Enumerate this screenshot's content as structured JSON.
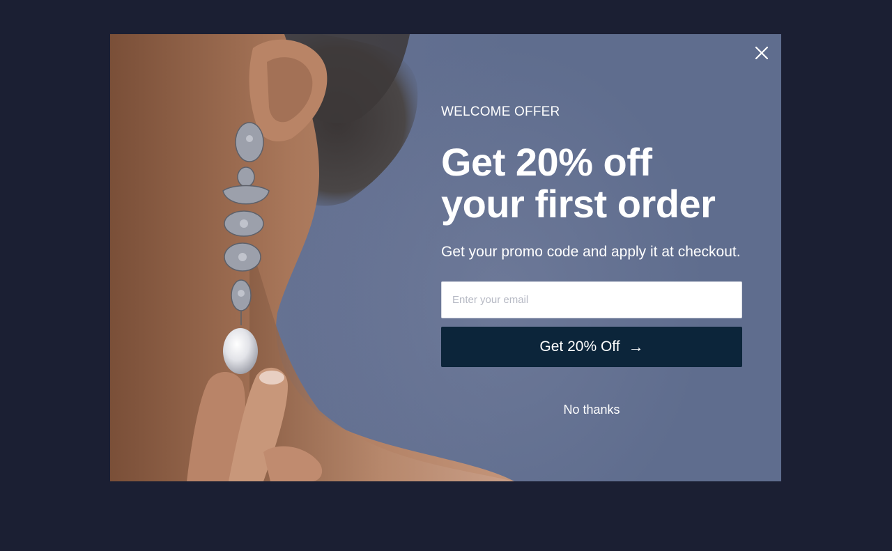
{
  "popup": {
    "eyebrow": "WELCOME OFFER",
    "headline_line1": "Get 20% off",
    "headline_line2": "your first order",
    "subtext": "Get your promo code and apply it at checkout.",
    "email_placeholder": "Enter your email",
    "email_value": "",
    "submit_label": "Get 20% Off",
    "submit_arrow": "→",
    "decline_label": "No thanks",
    "close_icon": "close-icon"
  },
  "colors": {
    "page_background": "#1b1f33",
    "modal_background": "#5f6d8e",
    "button_background": "#0c253a",
    "text": "#ffffff"
  },
  "image": {
    "subject": "woman wearing long silver chandelier earring with pearl drop"
  }
}
